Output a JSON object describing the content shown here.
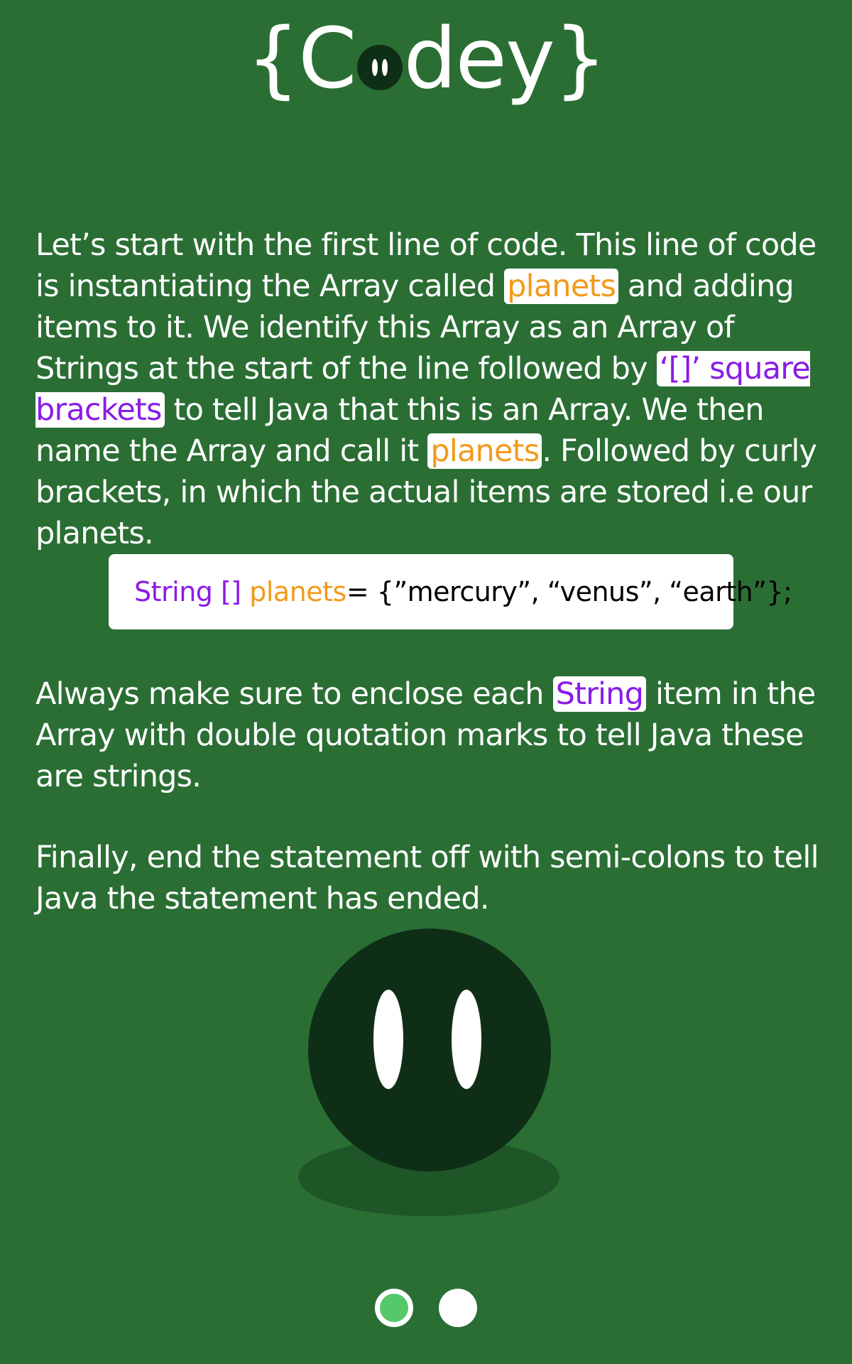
{
  "brand": {
    "logo_open": "{C",
    "logo_close": "dey}"
  },
  "colors": {
    "background": "#2a6e34",
    "mascot": "#0f2e16",
    "keyword_purple": "#8a1be6",
    "variable_orange": "#f29a1b",
    "active_dot": "#55c86a"
  },
  "paragraph1": {
    "t1": "Let’s start with the first line of code. This line of code is instantiating the Array called ",
    "h1": "planets",
    "t2": " and adding items to it. We identify this Array as an Array of Strings at the start of the line followed by ",
    "h2": "‘[]’ square brackets",
    "t3": " to tell Java that this is an Array. We then name the Array and call it ",
    "h3": "planets",
    "t4": ". Followed by curly brackets, in which the actual items are stored i.e our planets."
  },
  "code": {
    "type": "String []",
    "name": "planets",
    "rest": " = {”mercury”, “venus”, “earth”};"
  },
  "paragraph2": {
    "t1": "Always make sure to enclose each ",
    "h1": "String",
    "t2": " item in the Array with double quotation marks to tell Java these are strings."
  },
  "paragraph3": {
    "t1": "Finally, end the statement off with semi-colons to tell Java the statement has ended."
  },
  "pager": {
    "total": 2,
    "current": 1
  }
}
